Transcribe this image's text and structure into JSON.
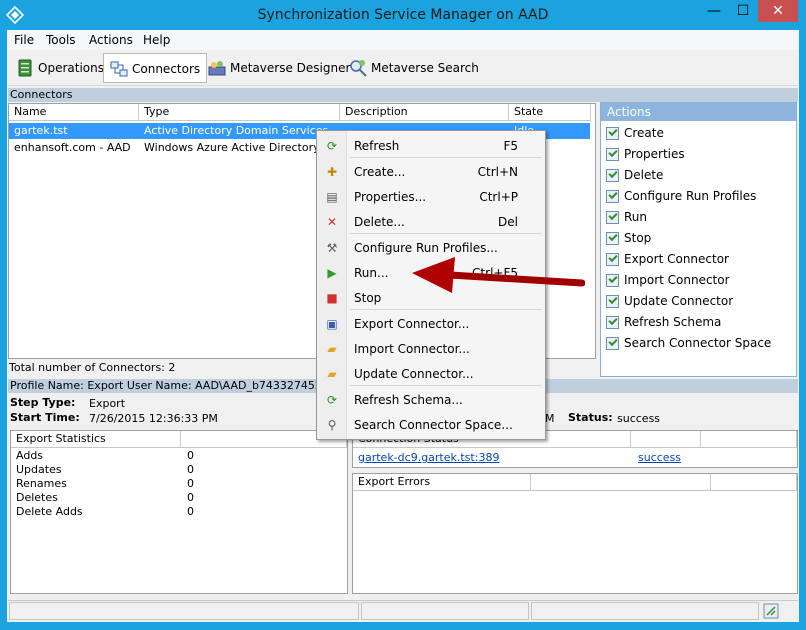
{
  "window": {
    "title": "Synchronization Service Manager on AAD",
    "minimize": "—",
    "maximize": "☐",
    "close": "✕"
  },
  "menu": [
    "File",
    "Tools",
    "Actions",
    "Help"
  ],
  "toolbar": {
    "operations": "Operations",
    "connectors": "Connectors",
    "metaverse_designer": "Metaverse Designer",
    "metaverse_search": "Metaverse Search"
  },
  "connectors": {
    "section_title": "Connectors",
    "columns": [
      "Name",
      "Type",
      "Description",
      "State"
    ],
    "rows": [
      {
        "name": "gartek.tst",
        "type": "Active Directory Domain Services",
        "description": "",
        "state": "Idle"
      },
      {
        "name": "enhansoft.com - AAD",
        "type": "Windows Azure Active Directory (Mic",
        "description": "",
        "state": ""
      }
    ],
    "total": "Total number of Connectors: 2"
  },
  "actions": {
    "title": "Actions",
    "items": [
      "Create",
      "Properties",
      "Delete",
      "Configure Run Profiles",
      "Run",
      "Stop",
      "Export Connector",
      "Import Connector",
      "Update Connector",
      "Refresh Schema",
      "Search Connector Space"
    ]
  },
  "profile": {
    "header": "Profile Name: Export  User Name: AAD\\AAD_b74332745254",
    "step_type_label": "Step Type:",
    "step_type": "Export",
    "start_time_label": "Start Time:",
    "start_time": "7/26/2015 12:36:33 PM",
    "end_time_fragment": "M",
    "status_label": "Status:",
    "status": "success"
  },
  "export_stats": {
    "title": "Export Statistics",
    "rows": [
      {
        "label": "Adds",
        "value": "0"
      },
      {
        "label": "Updates",
        "value": "0"
      },
      {
        "label": "Renames",
        "value": "0"
      },
      {
        "label": "Deletes",
        "value": "0"
      },
      {
        "label": "Delete Adds",
        "value": "0"
      }
    ]
  },
  "connection": {
    "header": "Connection Status",
    "server": "gartek-dc9.gartek.tst:389",
    "result": "success"
  },
  "export_errors": {
    "title": "Export Errors"
  },
  "context_menu": [
    {
      "label": "Refresh",
      "shortcut": "F5",
      "icon": "refresh-icon",
      "glyph": "⟳",
      "color": "#2e8b2e"
    },
    {
      "label": "Create...",
      "shortcut": "Ctrl+N",
      "icon": "create-icon",
      "glyph": "✚",
      "color": "#c08a00"
    },
    {
      "label": "Properties...",
      "shortcut": "Ctrl+P",
      "icon": "properties-icon",
      "glyph": "▤",
      "color": "#555555"
    },
    {
      "label": "Delete...",
      "shortcut": "Del",
      "icon": "delete-icon",
      "glyph": "✕",
      "color": "#d03030"
    },
    {
      "label": "Configure Run Profiles...",
      "shortcut": "",
      "icon": "configure-icon",
      "glyph": "⚒",
      "color": "#606060"
    },
    {
      "label": "Run...",
      "shortcut": "Ctrl+F5",
      "icon": "run-icon",
      "glyph": "▶",
      "color": "#2e9b2e"
    },
    {
      "label": "Stop",
      "shortcut": "",
      "icon": "stop-icon",
      "glyph": "■",
      "color": "#d03030"
    },
    {
      "label": "Export Connector...",
      "shortcut": "",
      "icon": "save-icon",
      "glyph": "▣",
      "color": "#3b5ea8"
    },
    {
      "label": "Import Connector...",
      "shortcut": "",
      "icon": "folder-open-icon",
      "glyph": "▰",
      "color": "#e0a526"
    },
    {
      "label": "Update Connector...",
      "shortcut": "",
      "icon": "folder-update-icon",
      "glyph": "▰",
      "color": "#e0a526"
    },
    {
      "label": "Refresh Schema...",
      "shortcut": "",
      "icon": "refresh-schema-icon",
      "glyph": "⟳",
      "color": "#2e8b2e"
    },
    {
      "label": "Search Connector Space...",
      "shortcut": "",
      "icon": "search-icon",
      "glyph": "⚲",
      "color": "#5a5a5a"
    }
  ],
  "colors": {
    "titlebar": "#1aa3df",
    "selection": "#3399ff",
    "arrow": "#c00000",
    "actions_header": "#8cb4dc"
  }
}
